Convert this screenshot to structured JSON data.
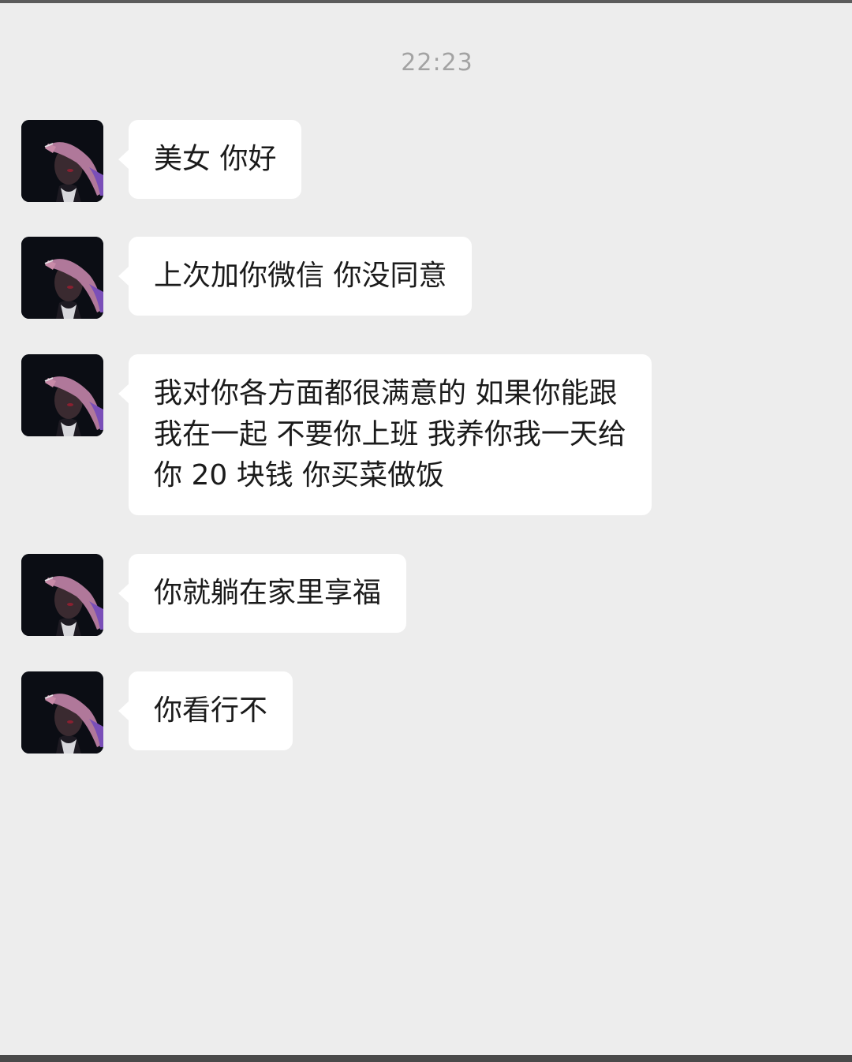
{
  "chat": {
    "timestamp": "22:23",
    "messages": [
      {
        "sender": "contact",
        "avatar": "avatar-photo",
        "text": "美女 你好"
      },
      {
        "sender": "contact",
        "avatar": "avatar-photo",
        "text": "上次加你微信 你没同意"
      },
      {
        "sender": "contact",
        "avatar": "avatar-photo",
        "text": "我对你各方面都很满意的 如果你能跟\n我在一起 不要你上班 我养你我一天给\n你 20 块钱 你买菜做饭"
      },
      {
        "sender": "contact",
        "avatar": "avatar-photo",
        "text": "你就躺在家里享福"
      },
      {
        "sender": "contact",
        "avatar": "avatar-photo",
        "text": "你看行不"
      }
    ]
  },
  "colors": {
    "background": "#ededed",
    "bubble": "#ffffff",
    "text": "#1b1b1b",
    "timestamp": "#a3a3a3"
  }
}
